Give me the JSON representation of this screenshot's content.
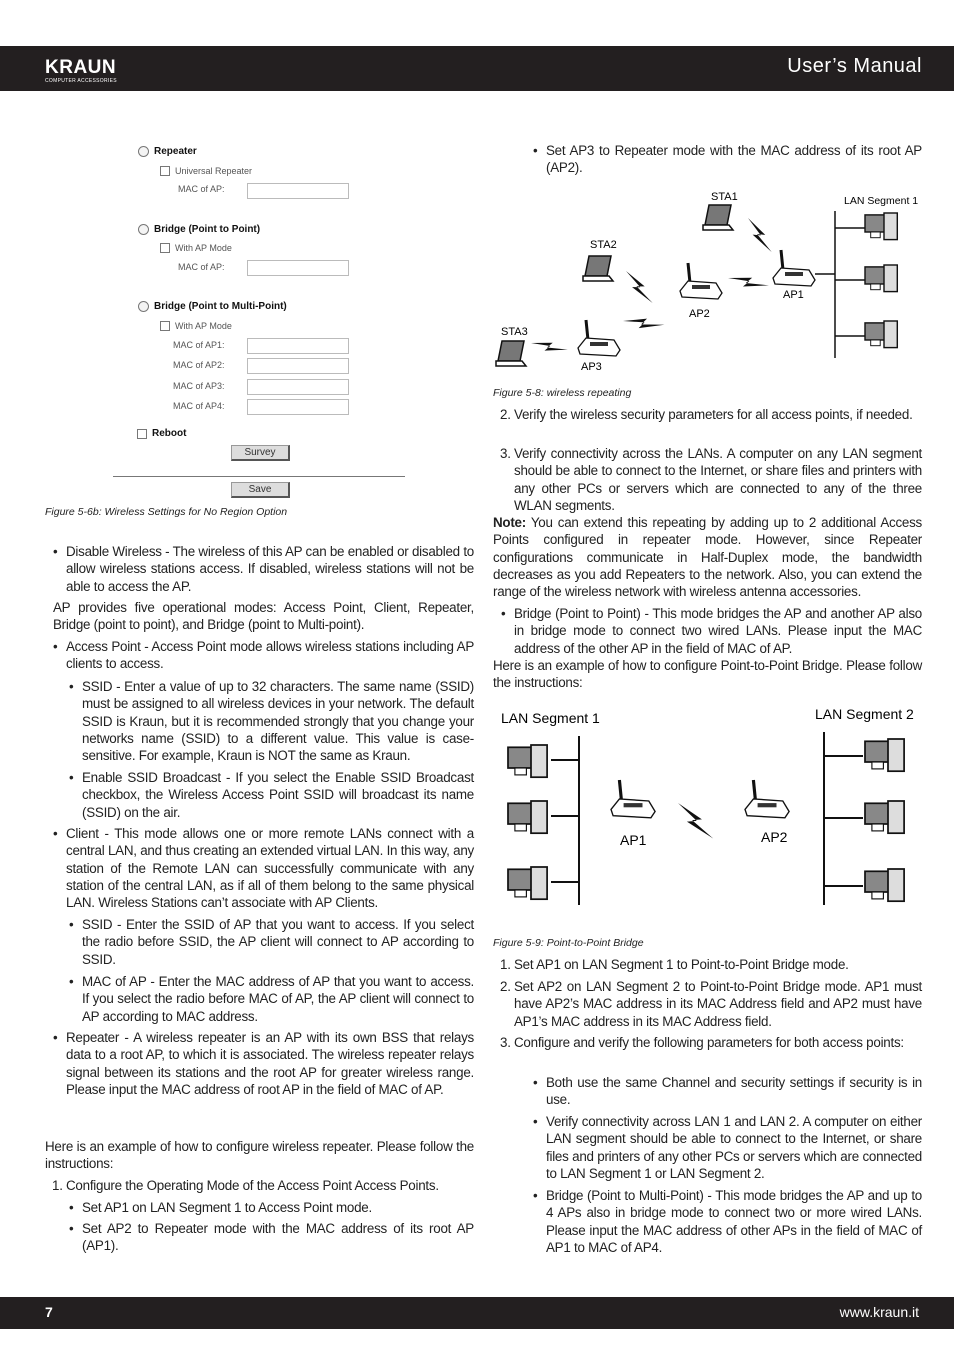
{
  "header": {
    "logo": "KRAUN",
    "logo_sub": "COMPUTER ACCESSORIES",
    "title": "User’s Manual"
  },
  "footer": {
    "page_number": "7",
    "url": "www.kraun.it"
  },
  "settings_form": {
    "repeater": "Repeater",
    "universal_repeater": "Universal Repeater",
    "mac_of_ap_1": "MAC of AP:",
    "bridge_p2p": "Bridge (Point to Point)",
    "with_ap_mode_1": "With AP Mode",
    "mac_of_ap_2": "MAC of AP:",
    "bridge_p2mp": "Bridge (Point to Multi-Point)",
    "with_ap_mode_2": "With AP Mode",
    "mac_ap1": "MAC of AP1:",
    "mac_ap2": "MAC of AP2:",
    "mac_ap3": "MAC of AP3:",
    "mac_ap4": "MAC of AP4:",
    "reboot": "Reboot",
    "survey": "Survey",
    "save": "Save",
    "caption": "Figure 5-6b: Wireless Settings for No Region Option"
  },
  "left": [
    {
      "type": "bullet",
      "text": "Disable Wireless - The wireless of this AP can be enabled or disabled to allow wireless stations access. If disabled, wireless stations will not be able to access the AP."
    },
    {
      "type": "para",
      "text": "AP provides five operational modes: Access Point, Client, Repeater, Bridge (point to point), and Bridge (point to Multi-point)."
    },
    {
      "type": "bullet",
      "text": "Access Point - Access Point mode allows wireless stations including AP clients to access."
    },
    {
      "type": "sub",
      "text": "SSID - Enter a value of up to 32 characters. The same name (SSID) must be assigned to all wireless devices in your network. The default SSID is Kraun, but it is recommended strongly that you change your networks name (SSID) to a different value. This value is case-sensitive. For example, Kraun is NOT the same as Kraun."
    },
    {
      "type": "sub",
      "text": "Enable SSID Broadcast - If you select the Enable SSID Broadcast checkbox, the Wireless Access Point SSID will broadcast its name (SSID) on the air."
    },
    {
      "type": "bullet",
      "text": "Client - This mode allows one or more remote LANs connect with a central LAN, and thus creating an extended virtual LAN. In this way, any station of the Remote LAN can successfully communicate with any station of the central LAN, as if all of them belong to the same physical LAN. Wireless Stations can’t associate with AP Clients."
    },
    {
      "type": "sub",
      "text": "SSID - Enter the SSID of AP that you want to access. If you select the radio before SSID, the AP client will connect to AP according to SSID."
    },
    {
      "type": "sub",
      "text": "MAC of AP - Enter the MAC address of AP that you want to access. If you select the radio before MAC of AP, the AP client will connect to AP according to MAC address."
    },
    {
      "type": "bullet",
      "text": "Repeater - A wireless repeater is an AP with its own BSS that relays data to a root AP, to which it is associated. The wireless repeater relays signal between its stations and the root AP for greater wireless range. Please input the MAC address of root AP in the field of MAC of AP."
    },
    {
      "type": "para0",
      "text": "Here is an example of how to configure wireless repeater. Please follow the instructions:"
    },
    {
      "type": "num",
      "marker": "1.",
      "text": "Configure the Operating Mode of the Access Point Access Points."
    },
    {
      "type": "sub",
      "text": "Set AP1 on LAN Segment 1 to Access Point mode."
    },
    {
      "type": "sub",
      "text": "Set AP2 to Repeater mode with the MAC address of its root AP (AP1)."
    }
  ],
  "right_top": {
    "type": "sub",
    "text": "Set AP3 to Repeater mode with the MAC address of its root AP (AP2)."
  },
  "figure_5_8": {
    "labels": {
      "sta1": "STA1",
      "sta2": "STA2",
      "sta3": "STA3",
      "ap1": "AP1",
      "ap2": "AP2",
      "ap3": "AP3",
      "lan": "LAN Segment 1"
    },
    "caption": "Figure 5-8: wireless repeating"
  },
  "right_mid": [
    {
      "type": "num",
      "marker": "2.",
      "text": "Verify the wireless security parameters for all access points, if needed."
    },
    {
      "type": "num",
      "marker": "3.",
      "text": "Verify connectivity across the LANs. A computer on any LAN segment should be able to connect to the Internet, or share files and printers with any other PCs or servers which are connected to any of the three WLAN segments."
    },
    {
      "type": "note",
      "label": "Note:",
      "text": " You can extend this repeating by adding up to 2 additional Access Points configured in repeater mode. However, since Repeater configurations communicate in Half-Duplex mode, the bandwidth decreases as you add Repeaters to the network. Also, you can extend the range of the wireless network with wireless antenna accessories."
    },
    {
      "type": "bullet",
      "text": "Bridge (Point to Point) - This mode bridges the AP and another AP also in bridge mode to connect two wired LANs. Please input the MAC address of the other AP in the field of MAC of AP."
    },
    {
      "type": "para0",
      "text": "Here is an example of how to configure Point-to-Point Bridge. Please follow the instructions:"
    }
  ],
  "figure_5_9": {
    "labels": {
      "lan1": "LAN Segment 1",
      "lan2": "LAN Segment 2",
      "ap1": "AP1",
      "ap2": "AP2"
    },
    "caption": "Figure 5-9: Point-to-Point Bridge"
  },
  "right_bottom": [
    {
      "type": "num",
      "marker": "1.",
      "text": "Set AP1 on LAN Segment 1 to Point-to-Point Bridge mode."
    },
    {
      "type": "num",
      "marker": "2.",
      "text": "Set AP2 on LAN Segment 2 to Point-to-Point Bridge mode. AP1 must have AP2’s MAC address in its MAC Address field and AP2 must have AP1’s MAC address in its MAC Address field."
    },
    {
      "type": "num",
      "marker": "3.",
      "text": "Configure and verify the following parameters for both access points:"
    },
    {
      "type": "sub",
      "text": "Both use the same Channel and security settings if security is in use."
    },
    {
      "type": "sub",
      "text": "Verify connectivity across LAN 1 and LAN 2. A computer on either LAN segment should be able to connect to the Internet, or share files and printers of any other PCs or servers which are connected to LAN Segment 1 or LAN Segment 2."
    },
    {
      "type": "sub",
      "text": "Bridge (Point to Multi-Point) - This mode bridges the AP and up to 4 APs also in bridge mode to connect two or more wired LANs. Please input the MAC address of other APs in the field of MAC of AP1 to MAC of AP4."
    }
  ]
}
